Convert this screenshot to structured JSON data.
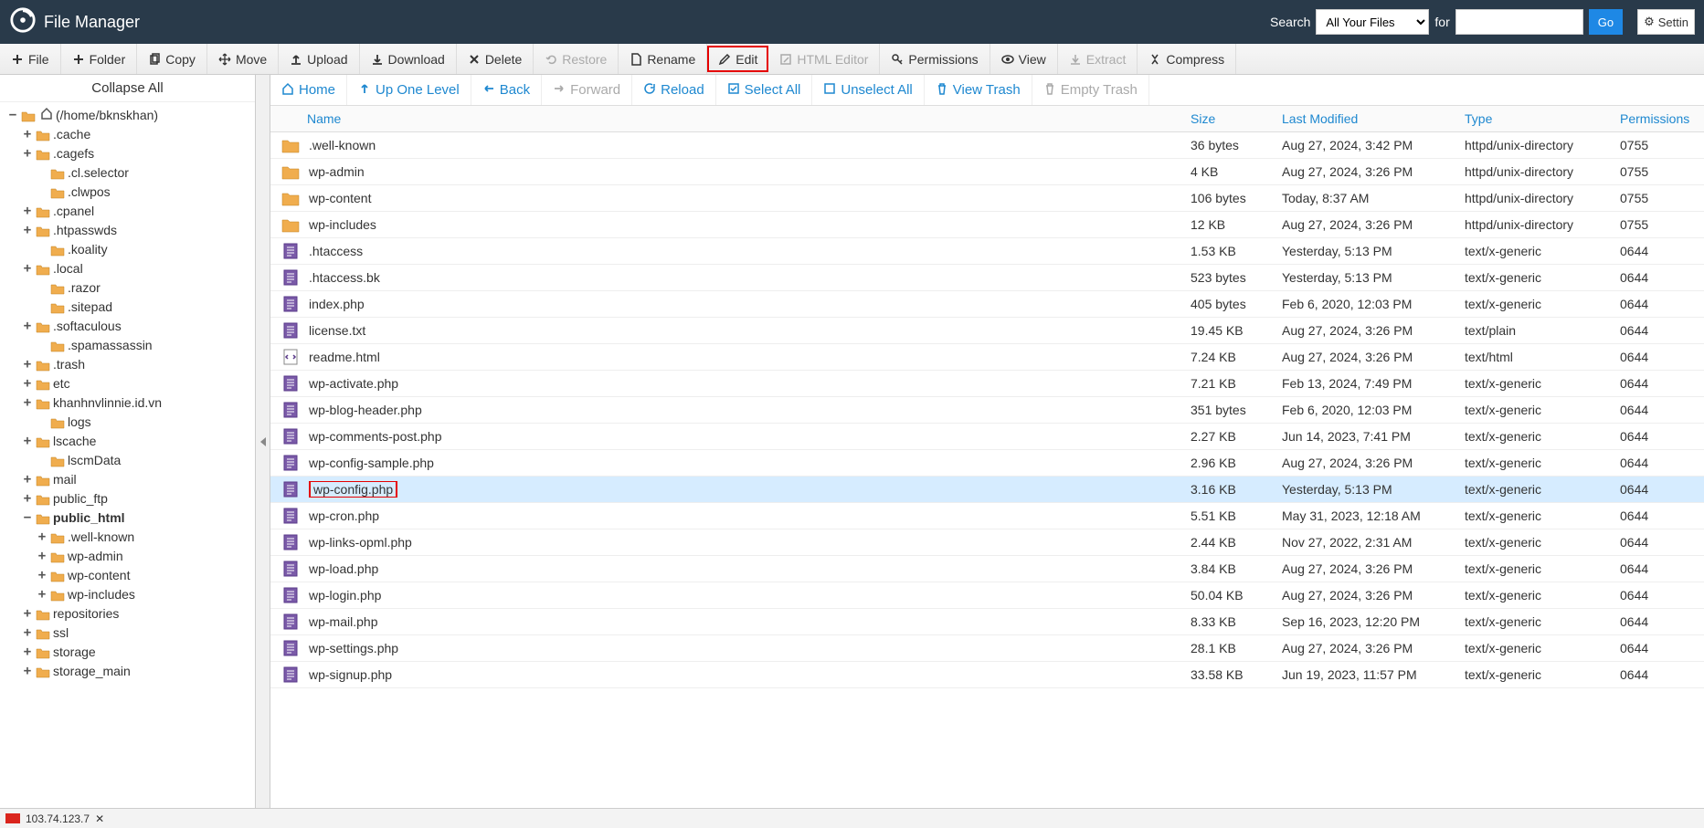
{
  "app_title": "File Manager",
  "header": {
    "search_label": "Search",
    "filter_value": "All Your Files",
    "for_label": "for",
    "go": "Go",
    "settings": "Settin"
  },
  "toolbar": [
    {
      "id": "file",
      "label": "File",
      "icon": "plus"
    },
    {
      "id": "folder",
      "label": "Folder",
      "icon": "plus"
    },
    {
      "id": "copy",
      "label": "Copy",
      "icon": "copy"
    },
    {
      "id": "move",
      "label": "Move",
      "icon": "move"
    },
    {
      "id": "upload",
      "label": "Upload",
      "icon": "upload"
    },
    {
      "id": "download",
      "label": "Download",
      "icon": "download"
    },
    {
      "id": "delete",
      "label": "Delete",
      "icon": "x"
    },
    {
      "id": "restore",
      "label": "Restore",
      "icon": "undo",
      "disabled": true
    },
    {
      "id": "rename",
      "label": "Rename",
      "icon": "file"
    },
    {
      "id": "edit",
      "label": "Edit",
      "icon": "pencil",
      "highlight": true
    },
    {
      "id": "htmleditor",
      "label": "HTML Editor",
      "icon": "edit",
      "disabled": true
    },
    {
      "id": "permissions",
      "label": "Permissions",
      "icon": "key"
    },
    {
      "id": "view",
      "label": "View",
      "icon": "eye"
    },
    {
      "id": "extract",
      "label": "Extract",
      "icon": "extract",
      "disabled": true
    },
    {
      "id": "compress",
      "label": "Compress",
      "icon": "compress"
    }
  ],
  "collapse_all": "Collapse All",
  "tree": [
    {
      "lvl": 0,
      "exp": "−",
      "label": "(/home/bknskhan)",
      "home": true,
      "fold": "open"
    },
    {
      "lvl": 1,
      "exp": "+",
      "label": ".cache"
    },
    {
      "lvl": 1,
      "exp": "+",
      "label": ".cagefs"
    },
    {
      "lvl": 2,
      "exp": "",
      "label": ".cl.selector"
    },
    {
      "lvl": 2,
      "exp": "",
      "label": ".clwpos"
    },
    {
      "lvl": 1,
      "exp": "+",
      "label": ".cpanel"
    },
    {
      "lvl": 1,
      "exp": "+",
      "label": ".htpasswds"
    },
    {
      "lvl": 2,
      "exp": "",
      "label": ".koality"
    },
    {
      "lvl": 1,
      "exp": "+",
      "label": ".local"
    },
    {
      "lvl": 2,
      "exp": "",
      "label": ".razor"
    },
    {
      "lvl": 2,
      "exp": "",
      "label": ".sitepad"
    },
    {
      "lvl": 1,
      "exp": "+",
      "label": ".softaculous"
    },
    {
      "lvl": 2,
      "exp": "",
      "label": ".spamassassin"
    },
    {
      "lvl": 1,
      "exp": "+",
      "label": ".trash"
    },
    {
      "lvl": 1,
      "exp": "+",
      "label": "etc"
    },
    {
      "lvl": 1,
      "exp": "+",
      "label": "khanhnvlinnie.id.vn"
    },
    {
      "lvl": 2,
      "exp": "",
      "label": "logs"
    },
    {
      "lvl": 1,
      "exp": "+",
      "label": "lscache"
    },
    {
      "lvl": 2,
      "exp": "",
      "label": "lscmData"
    },
    {
      "lvl": 1,
      "exp": "+",
      "label": "mail"
    },
    {
      "lvl": 1,
      "exp": "+",
      "label": "public_ftp"
    },
    {
      "lvl": 1,
      "exp": "−",
      "label": "public_html",
      "bold": true,
      "fold": "open"
    },
    {
      "lvl": 2,
      "exp": "+",
      "label": ".well-known"
    },
    {
      "lvl": 2,
      "exp": "+",
      "label": "wp-admin"
    },
    {
      "lvl": 2,
      "exp": "+",
      "label": "wp-content"
    },
    {
      "lvl": 2,
      "exp": "+",
      "label": "wp-includes"
    },
    {
      "lvl": 1,
      "exp": "+",
      "label": "repositories"
    },
    {
      "lvl": 1,
      "exp": "+",
      "label": "ssl"
    },
    {
      "lvl": 1,
      "exp": "+",
      "label": "storage"
    },
    {
      "lvl": 1,
      "exp": "+",
      "label": "storage_main"
    }
  ],
  "nav": [
    {
      "id": "home",
      "label": "Home",
      "icon": "home"
    },
    {
      "id": "up",
      "label": "Up One Level",
      "icon": "up"
    },
    {
      "id": "back",
      "label": "Back",
      "icon": "left"
    },
    {
      "id": "forward",
      "label": "Forward",
      "icon": "right",
      "disabled": true
    },
    {
      "id": "reload",
      "label": "Reload",
      "icon": "reload"
    },
    {
      "id": "selectall",
      "label": "Select All",
      "icon": "check"
    },
    {
      "id": "unselectall",
      "label": "Unselect All",
      "icon": "uncheck"
    },
    {
      "id": "viewtrash",
      "label": "View Trash",
      "icon": "trash"
    },
    {
      "id": "emptytrash",
      "label": "Empty Trash",
      "icon": "trash",
      "disabled": true
    }
  ],
  "columns": {
    "name": "Name",
    "size": "Size",
    "modified": "Last Modified",
    "type": "Type",
    "perms": "Permissions"
  },
  "files": [
    {
      "icon": "folder",
      "name": ".well-known",
      "size": "36 bytes",
      "mod": "Aug 27, 2024, 3:42 PM",
      "type": "httpd/unix-directory",
      "perm": "0755"
    },
    {
      "icon": "folder",
      "name": "wp-admin",
      "size": "4 KB",
      "mod": "Aug 27, 2024, 3:26 PM",
      "type": "httpd/unix-directory",
      "perm": "0755"
    },
    {
      "icon": "folder",
      "name": "wp-content",
      "size": "106 bytes",
      "mod": "Today, 8:37 AM",
      "type": "httpd/unix-directory",
      "perm": "0755"
    },
    {
      "icon": "folder",
      "name": "wp-includes",
      "size": "12 KB",
      "mod": "Aug 27, 2024, 3:26 PM",
      "type": "httpd/unix-directory",
      "perm": "0755"
    },
    {
      "icon": "file",
      "name": ".htaccess",
      "size": "1.53 KB",
      "mod": "Yesterday, 5:13 PM",
      "type": "text/x-generic",
      "perm": "0644"
    },
    {
      "icon": "file",
      "name": ".htaccess.bk",
      "size": "523 bytes",
      "mod": "Yesterday, 5:13 PM",
      "type": "text/x-generic",
      "perm": "0644"
    },
    {
      "icon": "file",
      "name": "index.php",
      "size": "405 bytes",
      "mod": "Feb 6, 2020, 12:03 PM",
      "type": "text/x-generic",
      "perm": "0644"
    },
    {
      "icon": "file",
      "name": "license.txt",
      "size": "19.45 KB",
      "mod": "Aug 27, 2024, 3:26 PM",
      "type": "text/plain",
      "perm": "0644"
    },
    {
      "icon": "html",
      "name": "readme.html",
      "size": "7.24 KB",
      "mod": "Aug 27, 2024, 3:26 PM",
      "type": "text/html",
      "perm": "0644"
    },
    {
      "icon": "file",
      "name": "wp-activate.php",
      "size": "7.21 KB",
      "mod": "Feb 13, 2024, 7:49 PM",
      "type": "text/x-generic",
      "perm": "0644"
    },
    {
      "icon": "file",
      "name": "wp-blog-header.php",
      "size": "351 bytes",
      "mod": "Feb 6, 2020, 12:03 PM",
      "type": "text/x-generic",
      "perm": "0644"
    },
    {
      "icon": "file",
      "name": "wp-comments-post.php",
      "size": "2.27 KB",
      "mod": "Jun 14, 2023, 7:41 PM",
      "type": "text/x-generic",
      "perm": "0644"
    },
    {
      "icon": "file",
      "name": "wp-config-sample.php",
      "size": "2.96 KB",
      "mod": "Aug 27, 2024, 3:26 PM",
      "type": "text/x-generic",
      "perm": "0644"
    },
    {
      "icon": "file",
      "name": "wp-config.php",
      "size": "3.16 KB",
      "mod": "Yesterday, 5:13 PM",
      "type": "text/x-generic",
      "perm": "0644",
      "selected": true,
      "highlight": true
    },
    {
      "icon": "file",
      "name": "wp-cron.php",
      "size": "5.51 KB",
      "mod": "May 31, 2023, 12:18 AM",
      "type": "text/x-generic",
      "perm": "0644"
    },
    {
      "icon": "file",
      "name": "wp-links-opml.php",
      "size": "2.44 KB",
      "mod": "Nov 27, 2022, 2:31 AM",
      "type": "text/x-generic",
      "perm": "0644"
    },
    {
      "icon": "file",
      "name": "wp-load.php",
      "size": "3.84 KB",
      "mod": "Aug 27, 2024, 3:26 PM",
      "type": "text/x-generic",
      "perm": "0644"
    },
    {
      "icon": "file",
      "name": "wp-login.php",
      "size": "50.04 KB",
      "mod": "Aug 27, 2024, 3:26 PM",
      "type": "text/x-generic",
      "perm": "0644"
    },
    {
      "icon": "file",
      "name": "wp-mail.php",
      "size": "8.33 KB",
      "mod": "Sep 16, 2023, 12:20 PM",
      "type": "text/x-generic",
      "perm": "0644"
    },
    {
      "icon": "file",
      "name": "wp-settings.php",
      "size": "28.1 KB",
      "mod": "Aug 27, 2024, 3:26 PM",
      "type": "text/x-generic",
      "perm": "0644"
    },
    {
      "icon": "file",
      "name": "wp-signup.php",
      "size": "33.58 KB",
      "mod": "Jun 19, 2023, 11:57 PM",
      "type": "text/x-generic",
      "perm": "0644"
    }
  ],
  "status": {
    "ip": "103.74.123.7"
  }
}
